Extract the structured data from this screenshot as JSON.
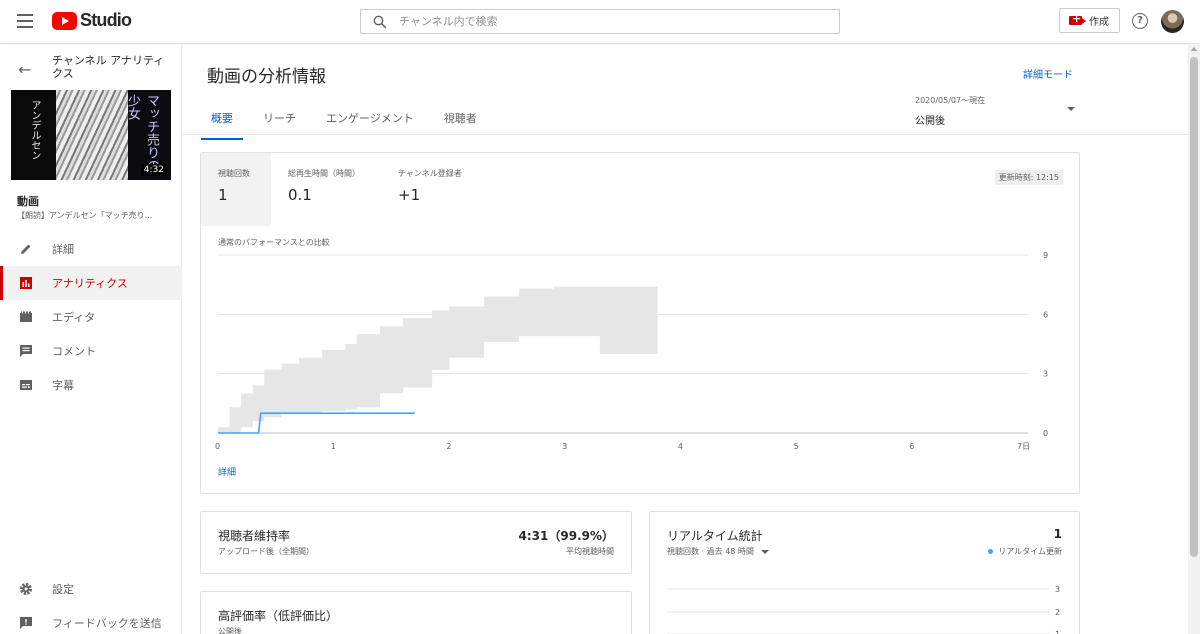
{
  "header": {
    "logo_text": "Studio",
    "search_placeholder": "チャンネル内で検索",
    "create_label": "作成",
    "help_symbol": "?"
  },
  "sidebar": {
    "title": "チャンネル アナリティクス",
    "thumbnail": {
      "left_text": "アンデルセン",
      "right_text": "マッチ売りの少女",
      "duration": "4:32"
    },
    "video_label": "動画",
    "video_title": "【朗読】アンデルセン「マッチ売り...",
    "items": [
      {
        "label": "詳細",
        "icon": "pencil-icon",
        "active": false
      },
      {
        "label": "アナリティクス",
        "icon": "analytics-icon",
        "active": true
      },
      {
        "label": "エディタ",
        "icon": "film-icon",
        "active": false
      },
      {
        "label": "コメント",
        "icon": "comment-icon",
        "active": false
      },
      {
        "label": "字幕",
        "icon": "subtitles-icon",
        "active": false
      }
    ],
    "bottom_items": [
      {
        "label": "設定",
        "icon": "gear-icon"
      },
      {
        "label": "フィードバックを送信",
        "icon": "feedback-icon"
      }
    ]
  },
  "main": {
    "page_title": "動画の分析情報",
    "detail_mode": "詳細モード",
    "tabs": [
      {
        "label": "概要",
        "active": true
      },
      {
        "label": "リーチ",
        "active": false
      },
      {
        "label": "エンゲージメント",
        "active": false
      },
      {
        "label": "視聴者",
        "active": false
      }
    ],
    "date_range": {
      "range": "2020/05/07〜現在",
      "label": "公開後"
    },
    "overview": {
      "metrics": [
        {
          "label": "視聴回数",
          "value": "1"
        },
        {
          "label": "総再生時間（時間）",
          "value": "0.1"
        },
        {
          "label": "チャンネル登録者",
          "value": "+1"
        }
      ],
      "updated": "更新時刻: 12:15",
      "chart_title": "通常のパフォーマンスとの比較",
      "chart_link": "詳細"
    },
    "retention": {
      "title": "視聴者維持率",
      "subtitle": "アップロード後（全期間）",
      "value": "4:31（99.9%）",
      "value_sub": "平均視聴時間"
    },
    "likes": {
      "title": "高評価率（低評価比）",
      "subtitle": "公開後"
    },
    "realtime": {
      "title": "リアルタイム統計",
      "subtitle": "視聴回数 · 過去 48 時間",
      "value": "1",
      "value_sub": "リアルタイム更新",
      "yticks": [
        "3",
        "2",
        "1"
      ]
    }
  },
  "colors": {
    "accent_blue": "#065fd4",
    "brand_red": "#ff0000",
    "active_red": "#cc0000",
    "line_blue": "#3ea6ff",
    "band_gray": "#e6e6e6"
  },
  "chart_data": {
    "type": "area",
    "title": "通常のパフォーマンスとの比較",
    "x_ticks": [
      "0",
      "1",
      "2",
      "3",
      "4",
      "5",
      "6",
      "7日"
    ],
    "y_ticks": [
      "0",
      "3",
      "6",
      "9"
    ],
    "xlim": [
      0,
      7
    ],
    "ylim": [
      0,
      9
    ],
    "grid": true,
    "series": [
      {
        "kind": "band",
        "x": [
          0,
          0.1,
          0.2,
          0.3,
          0.4,
          0.55,
          0.7,
          0.9,
          1.1,
          1.2,
          1.4,
          1.6,
          1.85,
          2.0,
          2.3,
          2.6,
          2.9,
          3.3,
          3.8
        ],
        "upper": [
          0.3,
          1.3,
          2.0,
          2.4,
          3.2,
          3.5,
          3.8,
          4.2,
          4.5,
          5.0,
          5.4,
          5.8,
          6.2,
          6.4,
          6.9,
          7.3,
          7.4,
          7.4,
          7.4
        ],
        "lower": [
          0,
          0,
          0.3,
          0.6,
          0.8,
          1.0,
          1.0,
          1.1,
          1.2,
          1.3,
          2.0,
          2.3,
          3.2,
          3.8,
          4.6,
          4.9,
          4.9,
          4.0,
          4.0
        ]
      },
      {
        "kind": "line",
        "x": [
          0,
          0.35,
          0.37,
          1.7
        ],
        "y": [
          0,
          0,
          1,
          1
        ]
      }
    ]
  }
}
